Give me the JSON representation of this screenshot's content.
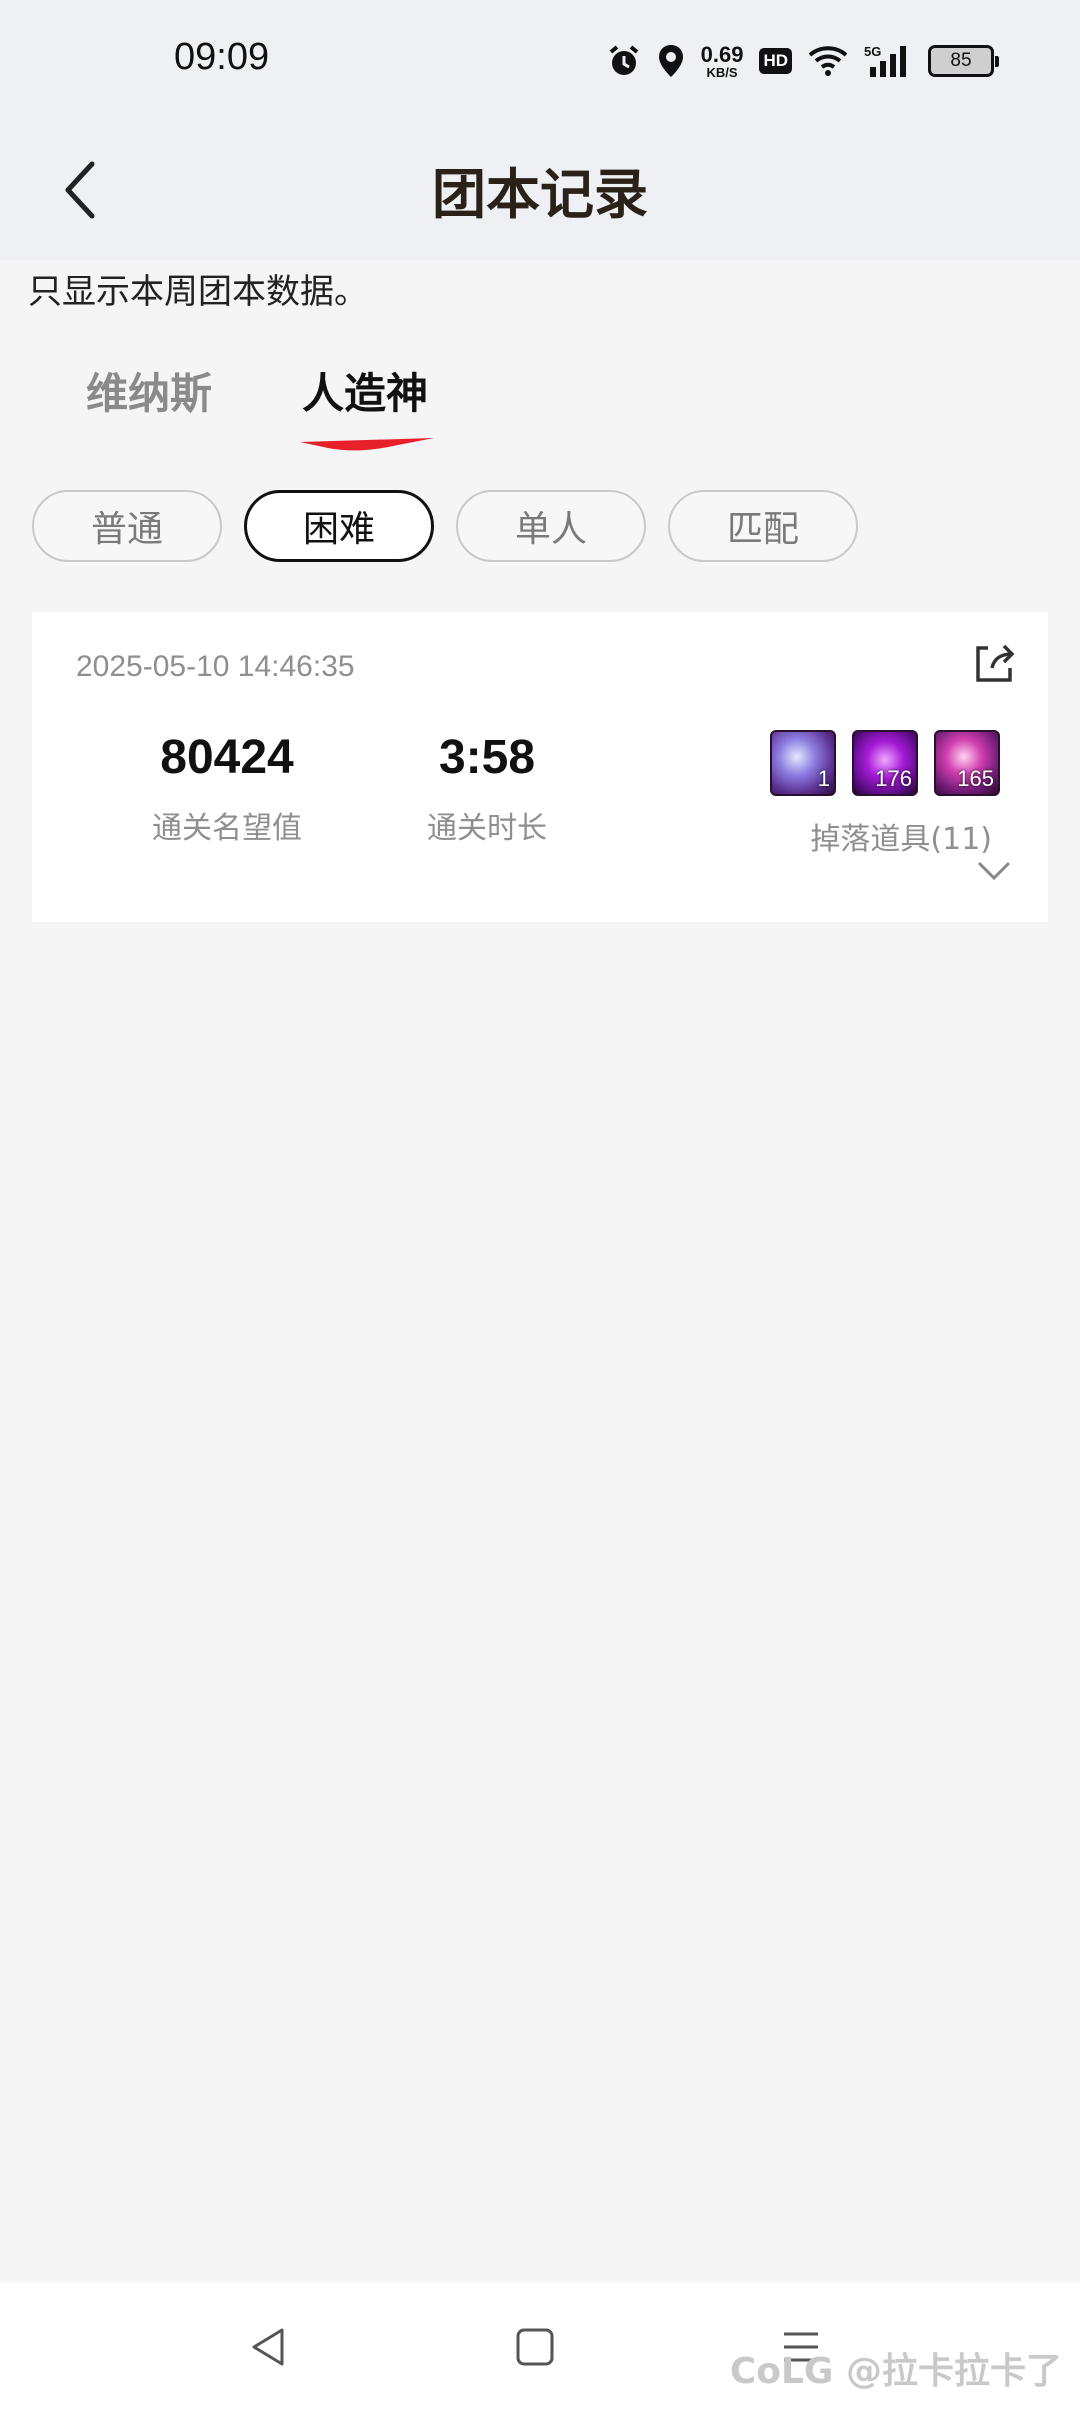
{
  "status": {
    "time": "09:09",
    "net_speed": "0.69",
    "net_unit": "KB/S",
    "hd": "HD",
    "signal": "5G",
    "battery": "85"
  },
  "header": {
    "title": "团本记录"
  },
  "notice": "只显示本周团本数据。",
  "tabs": [
    {
      "label": "维纳斯"
    },
    {
      "label": "人造神"
    }
  ],
  "filters": [
    {
      "label": "普通"
    },
    {
      "label": "困难"
    },
    {
      "label": "单人"
    },
    {
      "label": "匹配"
    }
  ],
  "record": {
    "date": "2025-05-10 14:46:35",
    "fame_value": "80424",
    "fame_label": "通关名望值",
    "duration_value": "3:58",
    "duration_label": "通关时长",
    "drops_label": "掉落道具(11)",
    "drops": [
      {
        "count": "1"
      },
      {
        "count": "176"
      },
      {
        "count": "165"
      }
    ]
  },
  "watermark": "CoLG @拉卡拉卡了",
  "colors": {
    "accent_red": "#e8202a",
    "active_chip_border": "#111111"
  }
}
